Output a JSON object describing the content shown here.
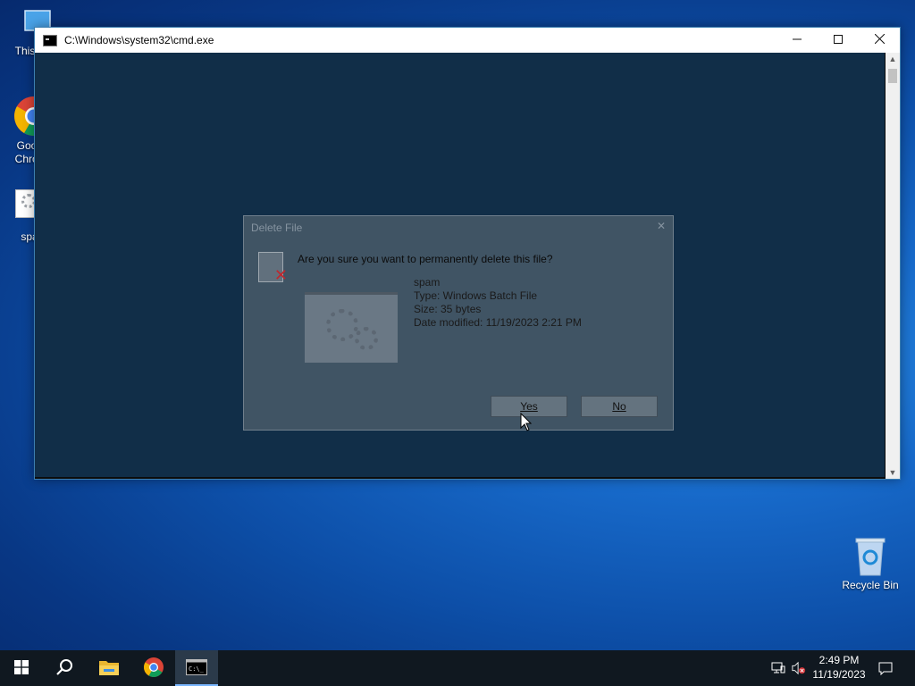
{
  "desktop": {
    "icons": [
      {
        "label": "This PC",
        "icon": "this-pc-icon"
      },
      {
        "label": "Google Chrome",
        "icon": "chrome-icon"
      },
      {
        "label": "spam",
        "icon": "batch-file-icon"
      },
      {
        "label": "Recycle Bin",
        "icon": "recycle-bin-icon"
      }
    ]
  },
  "cmd_window": {
    "title": "C:\\Windows\\system32\\cmd.exe",
    "minimize_icon": "minimize-icon",
    "maximize_icon": "maximize-icon",
    "close_icon": "close-icon"
  },
  "delete_dialog": {
    "title": "Delete File",
    "question": "Are you sure you want to permanently delete this file?",
    "file_name": "spam",
    "file_type": "Type: Windows Batch File",
    "file_size": "Size: 35 bytes",
    "date_modified": "Date modified: 11/19/2023 2:21 PM",
    "yes_label": "Yes",
    "no_label": "No"
  },
  "taskbar": {
    "items": [
      {
        "name": "start-button",
        "icon": "windows-logo-icon"
      },
      {
        "name": "search-button",
        "icon": "search-icon"
      },
      {
        "name": "file-explorer-button",
        "icon": "folder-icon"
      },
      {
        "name": "chrome-button",
        "icon": "chrome-icon"
      },
      {
        "name": "cmd-button",
        "icon": "cmd-icon",
        "active": true
      }
    ],
    "tray": {
      "network_icon": "network-icon",
      "volume_icon": "volume-muted-icon",
      "notification_icon": "notification-icon"
    },
    "clock": {
      "time": "2:49 PM",
      "date": "11/19/2023"
    }
  },
  "colors": {
    "taskbar_bg": "#101820",
    "accent": "#0078d7",
    "delete_x": "#c0272d"
  }
}
